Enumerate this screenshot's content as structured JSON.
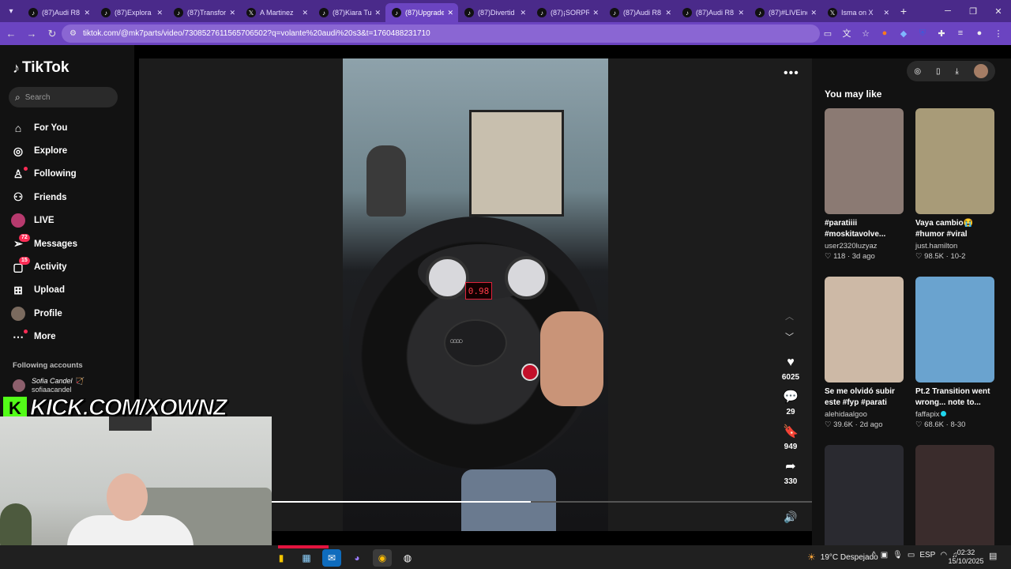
{
  "browser": {
    "tabs": [
      {
        "label": "(87)Audi R8",
        "icon": "tiktok-icon",
        "active": false
      },
      {
        "label": "(87)Explora",
        "icon": "tiktok-icon",
        "active": false
      },
      {
        "label": "(87)Transform",
        "icon": "tiktok-icon",
        "active": false
      },
      {
        "label": "A Martinez",
        "icon": "x-icon",
        "active": false
      },
      {
        "label": "(87)Kiara Tu",
        "icon": "tiktok-icon",
        "active": false
      },
      {
        "label": "(87)Upgrade",
        "icon": "tiktok-icon",
        "active": true
      },
      {
        "label": "(87)Divertid",
        "icon": "tiktok-icon",
        "active": false
      },
      {
        "label": "(87)¡SORPRE",
        "icon": "tiktok-icon",
        "active": false
      },
      {
        "label": "(87)Audi R8",
        "icon": "tiktok-icon",
        "active": false
      },
      {
        "label": "(87)Audi R8",
        "icon": "tiktok-icon",
        "active": false
      },
      {
        "label": "(87)#LIVEinc",
        "icon": "tiktok-icon",
        "active": false
      },
      {
        "label": "Isma on X",
        "icon": "x-icon",
        "active": false
      }
    ],
    "url": "tiktok.com/@mk7parts/video/7308527611565706502?q=volante%20audi%20s3&t=1760488231710"
  },
  "tiktok": {
    "logo": "TikTok",
    "search_placeholder": "Search",
    "nav": [
      {
        "label": "For You",
        "icon": "home-icon",
        "badge": ""
      },
      {
        "label": "Explore",
        "icon": "compass-icon",
        "badge": ""
      },
      {
        "label": "Following",
        "icon": "following-icon",
        "badge": "dot"
      },
      {
        "label": "Friends",
        "icon": "friends-icon",
        "badge": ""
      },
      {
        "label": "LIVE",
        "icon": "live-icon",
        "badge": ""
      },
      {
        "label": "Messages",
        "icon": "messages-icon",
        "badge": "72"
      },
      {
        "label": "Activity",
        "icon": "activity-icon",
        "badge": "15"
      },
      {
        "label": "Upload",
        "icon": "upload-icon",
        "badge": ""
      },
      {
        "label": "Profile",
        "icon": "profile-icon",
        "badge": ""
      },
      {
        "label": "More",
        "icon": "more-icon",
        "badge": "dot"
      }
    ],
    "following_title": "Following accounts",
    "following_account": {
      "name": "Sofia Candel 🏹",
      "handle": "sofiaacandel"
    }
  },
  "player": {
    "speed_display": "0.98",
    "progress": 0.48,
    "likes": "6025",
    "comments": "29",
    "saves": "949",
    "shares": "330"
  },
  "you_may_like": {
    "title": "You may like",
    "cards": [
      {
        "title": "#paratiiii #moskitavolve...",
        "user": "user2320luzyaz",
        "likes": "118",
        "date": "3d ago",
        "verified": false,
        "color": "#8b7a73"
      },
      {
        "title": "Vaya cambio😭 #humor #viral",
        "user": "just.hamilton",
        "likes": "98.5K",
        "date": "10-2",
        "verified": false,
        "color": "#a89b78"
      },
      {
        "title": "Se me olvidó subir este #fyp #parati",
        "user": "alehidaalgoo",
        "likes": "39.6K",
        "date": "2d ago",
        "verified": false,
        "color": "#cdb9a6"
      },
      {
        "title": "Pt.2 Transition went wrong... note to...",
        "user": "faffapix",
        "likes": "68.6K",
        "date": "8-30",
        "verified": true,
        "color": "#6aa3cf"
      },
      {
        "title": "",
        "user": "",
        "likes": "",
        "date": "",
        "verified": false,
        "color": "#2a2a30"
      },
      {
        "title": "",
        "user": "",
        "likes": "",
        "date": "",
        "verified": false,
        "color": "#3a2c2c"
      }
    ]
  },
  "overlay": {
    "kick_text": "KICK.COM/XOWNZ",
    "kick_logo": "K"
  },
  "taskbar": {
    "weather": "19°C  Despejado",
    "lang": "ESP",
    "time": "02:32",
    "date": "15/10/2025"
  }
}
